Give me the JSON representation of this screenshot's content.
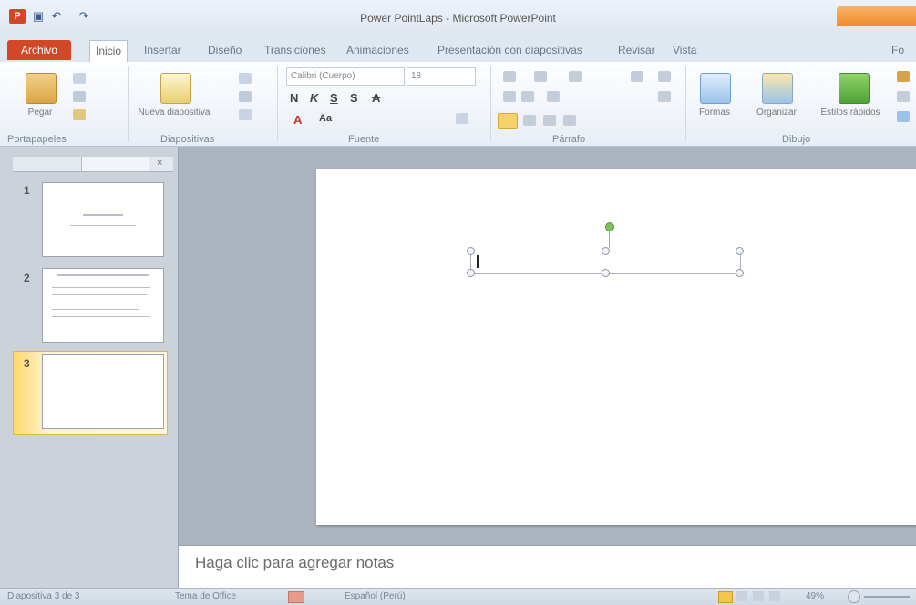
{
  "title_bar": {
    "app_icon": "P",
    "window_title": "Power PointLaps - Microsoft PowerPoint",
    "save_icon": "save-icon",
    "undo_icon": "undo-icon",
    "redo_icon": "redo-icon"
  },
  "tabs": {
    "file": "Archivo",
    "home": "Inicio",
    "insert": "Insertar",
    "design": "Diseño",
    "transitions": "Transiciones",
    "animations": "Animaciones",
    "slideshow": "Presentación con diapositivas",
    "review": "Revisar",
    "view": "Vista",
    "format": "Fo"
  },
  "ribbon": {
    "clipboard": {
      "paste": "Pegar",
      "label": "Portapapeles"
    },
    "slides": {
      "new_slide": "Nueva diapositiva",
      "label": "Diapositivas"
    },
    "font": {
      "font_name": "Calibri (Cuerpo)",
      "font_size": "18",
      "bold": "N",
      "italic": "K",
      "underline": "S",
      "strike": "S",
      "grow": "A",
      "shrink": "A",
      "change_case": "Aa",
      "label": "Fuente"
    },
    "paragraph": {
      "label": "Párrafo"
    },
    "drawing": {
      "shapes": "Formas",
      "arrange": "Organizar",
      "quick_styles": "Estilos rápidos",
      "label": "Dibujo"
    }
  },
  "slides_pane": {
    "numbers": [
      "1",
      "2",
      "3"
    ]
  },
  "notes": {
    "placeholder": "Haga clic para agregar notas"
  },
  "status_bar": {
    "slide_info": "Diapositiva 3 de 3",
    "theme": "Tema de Office",
    "language": "Español (Perú)",
    "zoom": "49%"
  },
  "colors": {
    "file_tab": "#d24726",
    "selected_slide": "#ffd86a",
    "context_tab": "#f08b2b"
  }
}
